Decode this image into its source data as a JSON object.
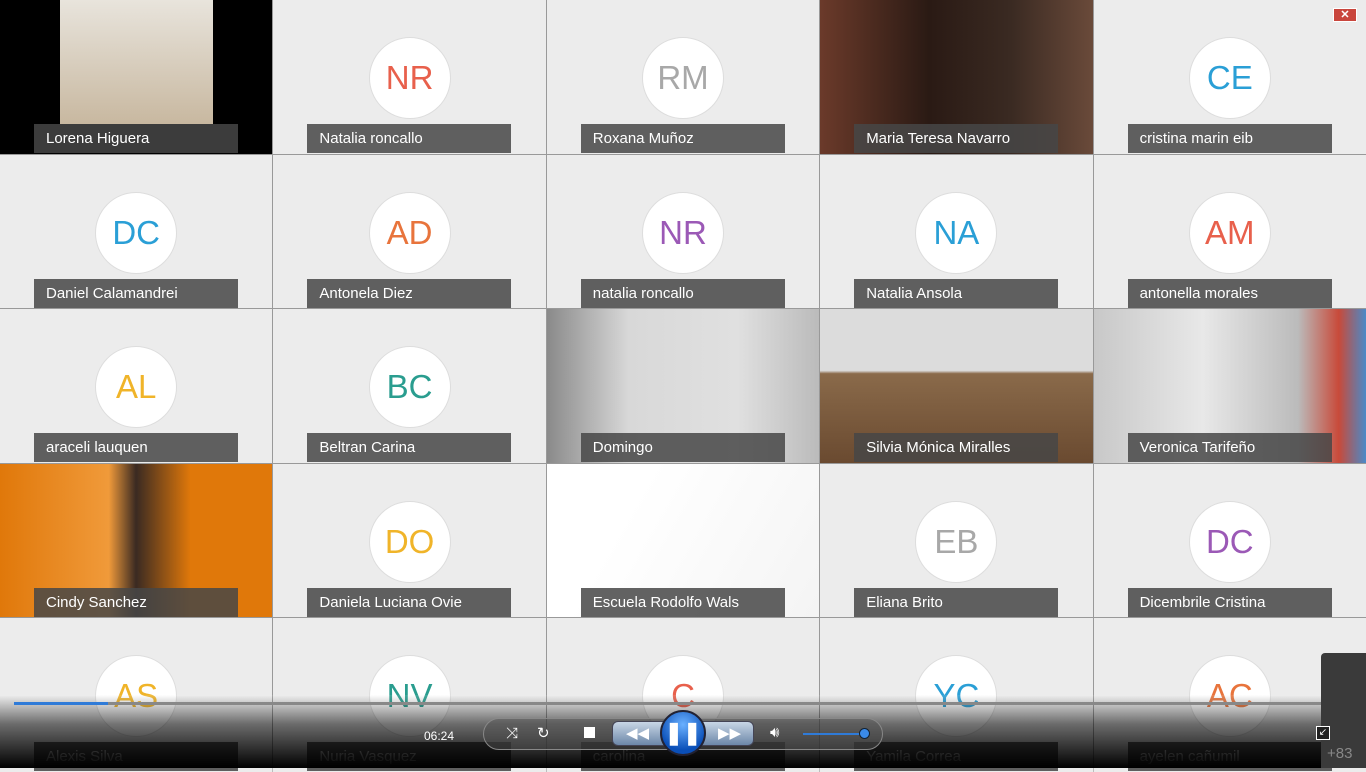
{
  "participants": [
    {
      "name": "Lorena Higuera",
      "video": "lorena"
    },
    {
      "name": "Natalia roncallo",
      "initials": "NR",
      "color": "#e8604c"
    },
    {
      "name": "Roxana Muñoz",
      "initials": "RM",
      "color": "#a8a8a8"
    },
    {
      "name": "Maria Teresa Navarro",
      "video": "maria"
    },
    {
      "name": "cristina marin eib",
      "initials": "CE",
      "color": "#2a9fd6"
    },
    {
      "name": "Daniel Calamandrei",
      "initials": "DC",
      "color": "#2a9fd6"
    },
    {
      "name": "Antonela Diez",
      "initials": "AD",
      "color": "#e8743c"
    },
    {
      "name": "natalia roncallo",
      "initials": "NR",
      "color": "#9b59b6"
    },
    {
      "name": "Natalia Ansola",
      "initials": "NA",
      "color": "#2a9fd6"
    },
    {
      "name": "antonella morales",
      "initials": "AM",
      "color": "#e8604c"
    },
    {
      "name": "araceli lauquen",
      "initials": "AL",
      "color": "#f0b429"
    },
    {
      "name": "Beltran Carina",
      "initials": "BC",
      "color": "#2a9d8f"
    },
    {
      "name": "Domingo",
      "video": "domingo"
    },
    {
      "name": "Silvia Mónica Miralles",
      "video": "silvia"
    },
    {
      "name": "Veronica Tarifeño",
      "video": "veronica"
    },
    {
      "name": "Cindy Sanchez",
      "video": "cindy"
    },
    {
      "name": "Daniela Luciana Ovie",
      "initials": "DO",
      "color": "#f0b429"
    },
    {
      "name": "Escuela Rodolfo Wals",
      "video": "escuela"
    },
    {
      "name": "Eliana Brito",
      "initials": "EB",
      "color": "#a8a8a8"
    },
    {
      "name": "Dicembrile Cristina",
      "initials": "DC",
      "color": "#9b59b6"
    },
    {
      "name": "Alexis Silva",
      "initials": "AS",
      "color": "#f0b429"
    },
    {
      "name": "Nuria Vasquez",
      "initials": "NV",
      "color": "#2a9d8f"
    },
    {
      "name": "carolina",
      "initials": "C",
      "color": "#e8604c"
    },
    {
      "name": "Yamila Correa",
      "initials": "YC",
      "color": "#2a9fd6"
    },
    {
      "name": "ayelen cañumil",
      "initials": "AC",
      "color": "#e8743c"
    }
  ],
  "player": {
    "time": "06:24",
    "progress_percent": 7,
    "volume_percent": 100,
    "more_participants": "+83",
    "state": "playing"
  },
  "icons": {
    "close": "close-icon",
    "shuffle": "shuffle-icon",
    "repeat": "repeat-icon",
    "stop": "stop-icon",
    "rewind": "rewind-icon",
    "pause": "pause-icon",
    "forward": "fast-forward-icon",
    "volume": "volume-icon",
    "fullscreen": "exit-fullscreen-icon"
  }
}
